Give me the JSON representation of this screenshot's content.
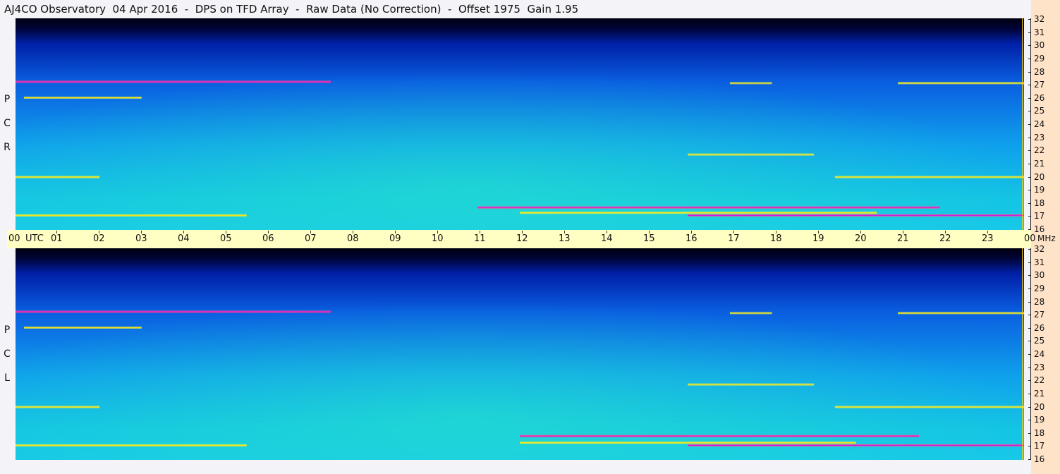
{
  "header": {
    "title": "AJ4CO Observatory  04 Apr 2016  -  DPS on TFD Array  -  Raw Data (No Correction)  -  Offset 1975  Gain 1.95"
  },
  "panels": [
    {
      "id": "rcp",
      "label_letters": [
        "P",
        "C",
        "R"
      ]
    },
    {
      "id": "lcp",
      "label_letters": [
        "P",
        "C",
        "L"
      ]
    }
  ],
  "time_axis": {
    "start_label": "00",
    "unit_label": "UTC",
    "hours": [
      "01",
      "02",
      "03",
      "04",
      "05",
      "06",
      "07",
      "08",
      "09",
      "10",
      "11",
      "12",
      "13",
      "14",
      "15",
      "16",
      "17",
      "18",
      "19",
      "20",
      "21",
      "22",
      "23"
    ],
    "end_label": "00",
    "freq_unit_label": "MHz"
  },
  "freq_axis": {
    "ticks": [
      "32",
      "31",
      "30",
      "29",
      "28",
      "27",
      "26",
      "25",
      "24",
      "23",
      "22",
      "21",
      "20",
      "19",
      "18",
      "17",
      "16"
    ]
  },
  "colors": {
    "timebar": "#ffffc4",
    "right_strip": "#ffe3c8",
    "marker_line": "#ffd000"
  },
  "chart_data": [
    {
      "type": "heatmap",
      "title": "",
      "panel_label": "R C P",
      "xlabel": "UTC",
      "ylabel": "MHz",
      "x_range_hours": [
        0,
        24
      ],
      "y_range_mhz": [
        16,
        32
      ],
      "features": [
        {
          "freq_mhz": 27.2,
          "start_hour": 0.0,
          "end_hour": 7.5,
          "intensity": 0.85
        },
        {
          "freq_mhz": 27.1,
          "start_hour": 17.0,
          "end_hour": 18.0,
          "intensity": 0.6
        },
        {
          "freq_mhz": 27.1,
          "start_hour": 21.0,
          "end_hour": 24.0,
          "intensity": 0.7
        },
        {
          "freq_mhz": 26.0,
          "start_hour": 0.2,
          "end_hour": 3.0,
          "intensity": 0.65
        },
        {
          "freq_mhz": 21.7,
          "start_hour": 16.0,
          "end_hour": 19.0,
          "intensity": 0.7
        },
        {
          "freq_mhz": 20.0,
          "start_hour": 0.0,
          "end_hour": 2.0,
          "intensity": 0.8
        },
        {
          "freq_mhz": 20.0,
          "start_hour": 19.5,
          "end_hour": 24.0,
          "intensity": 0.75
        },
        {
          "freq_mhz": 17.7,
          "start_hour": 11.0,
          "end_hour": 22.0,
          "intensity": 0.9
        },
        {
          "freq_mhz": 17.3,
          "start_hour": 12.0,
          "end_hour": 20.5,
          "intensity": 0.8
        },
        {
          "freq_mhz": 17.1,
          "start_hour": 0.0,
          "end_hour": 5.5,
          "intensity": 0.8
        },
        {
          "freq_mhz": 17.1,
          "start_hour": 16.0,
          "end_hour": 24.0,
          "intensity": 0.85
        }
      ]
    },
    {
      "type": "heatmap",
      "title": "",
      "panel_label": "L C P",
      "xlabel": "UTC",
      "ylabel": "MHz",
      "x_range_hours": [
        0,
        24
      ],
      "y_range_mhz": [
        16,
        32
      ],
      "features": [
        {
          "freq_mhz": 27.2,
          "start_hour": 0.0,
          "end_hour": 7.5,
          "intensity": 0.85
        },
        {
          "freq_mhz": 27.1,
          "start_hour": 17.0,
          "end_hour": 18.0,
          "intensity": 0.6
        },
        {
          "freq_mhz": 27.1,
          "start_hour": 21.0,
          "end_hour": 24.0,
          "intensity": 0.7
        },
        {
          "freq_mhz": 26.0,
          "start_hour": 0.2,
          "end_hour": 3.0,
          "intensity": 0.65
        },
        {
          "freq_mhz": 21.7,
          "start_hour": 16.0,
          "end_hour": 19.0,
          "intensity": 0.7
        },
        {
          "freq_mhz": 20.0,
          "start_hour": 0.0,
          "end_hour": 2.0,
          "intensity": 0.8
        },
        {
          "freq_mhz": 20.0,
          "start_hour": 19.5,
          "end_hour": 24.0,
          "intensity": 0.75
        },
        {
          "freq_mhz": 17.8,
          "start_hour": 12.0,
          "end_hour": 21.5,
          "intensity": 0.9
        },
        {
          "freq_mhz": 17.3,
          "start_hour": 12.0,
          "end_hour": 20.0,
          "intensity": 0.8
        },
        {
          "freq_mhz": 17.1,
          "start_hour": 0.0,
          "end_hour": 5.5,
          "intensity": 0.8
        },
        {
          "freq_mhz": 17.1,
          "start_hour": 16.0,
          "end_hour": 24.0,
          "intensity": 0.85
        }
      ]
    }
  ]
}
